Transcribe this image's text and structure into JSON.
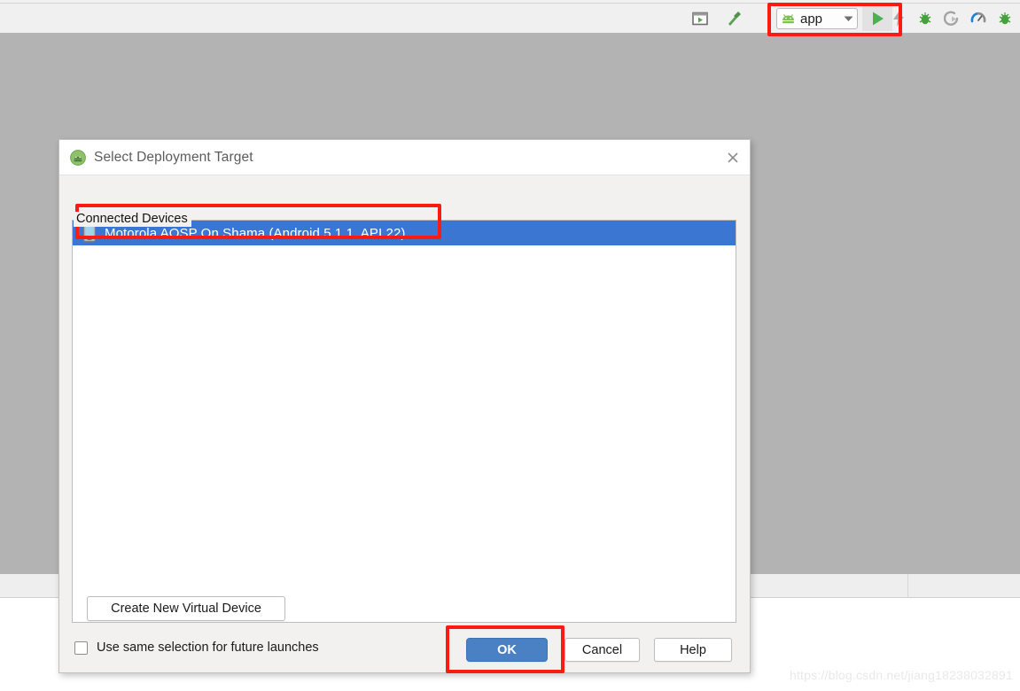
{
  "toolbar": {
    "run_config": {
      "label": "app",
      "icon": "android-head-icon",
      "dropdown_icon": "chevron-down-icon"
    },
    "buttons": [
      {
        "name": "preview-layout-icon",
        "title": ""
      },
      {
        "name": "build-hammer-icon",
        "title": ""
      },
      {
        "name": "run-icon",
        "title": ""
      },
      {
        "name": "apply-changes-icon",
        "title": ""
      },
      {
        "name": "debug-bug-icon",
        "title": ""
      },
      {
        "name": "attach-debugger-icon",
        "title": ""
      },
      {
        "name": "profiler-icon",
        "title": ""
      },
      {
        "name": "debug-bug-2-icon",
        "title": ""
      }
    ]
  },
  "dialog": {
    "title": "Select Deployment Target",
    "title_icon": "android-studio-icon",
    "close_icon": "close-icon",
    "group_legend": "Connected Devices",
    "devices": [
      {
        "label": "Motorola AOSP On Shama (Android 5.1.1, API 22)",
        "icon": "phone-icon",
        "selected": true
      }
    ],
    "create_vd_button": "Create New Virtual Device",
    "checkbox": {
      "label": "Use same selection for future launches",
      "checked": false
    },
    "buttons": {
      "ok": "OK",
      "cancel": "Cancel",
      "help": "Help"
    }
  },
  "annotations": {
    "highlight_color": "#fb1b10",
    "boxes": [
      {
        "name": "run-config-highlight"
      },
      {
        "name": "device-row-highlight"
      },
      {
        "name": "ok-button-highlight"
      }
    ]
  },
  "watermark": "https://blog.csdn.net/jiang18238032891",
  "colors": {
    "selection_blue": "#3a76d2",
    "ok_button_blue": "#4a81c4",
    "android_green": "#6ab344",
    "editor_gray": "#b3b3b3"
  }
}
